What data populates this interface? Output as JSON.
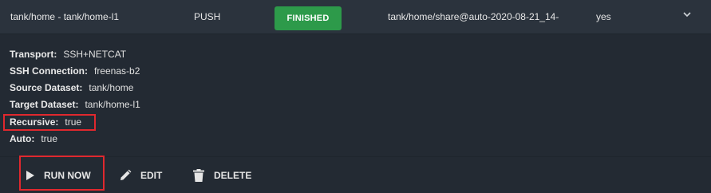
{
  "task_row": {
    "name": "tank/home - tank/home-l1",
    "direction": "PUSH",
    "status": "FINISHED",
    "snapshot": "tank/home/share@auto-2020-08-21_14-",
    "enabled": "yes",
    "expand_icon": "chevron-down-icon"
  },
  "details": [
    {
      "label": "Transport:",
      "value": "SSH+NETCAT"
    },
    {
      "label": "SSH Connection:",
      "value": "freenas-b2"
    },
    {
      "label": "Source Dataset:",
      "value": "tank/home"
    },
    {
      "label": "Target Dataset:",
      "value": "tank/home-l1"
    },
    {
      "label": "Recursive:",
      "value": "true"
    },
    {
      "label": "Auto:",
      "value": "true"
    }
  ],
  "actions": {
    "run_now": "RUN NOW",
    "edit": "EDIT",
    "delete": "DELETE"
  },
  "colors": {
    "background": "#232a33",
    "row_background": "#2b333d",
    "status_finished": "#2d9a4a",
    "highlight": "#e0282e"
  }
}
